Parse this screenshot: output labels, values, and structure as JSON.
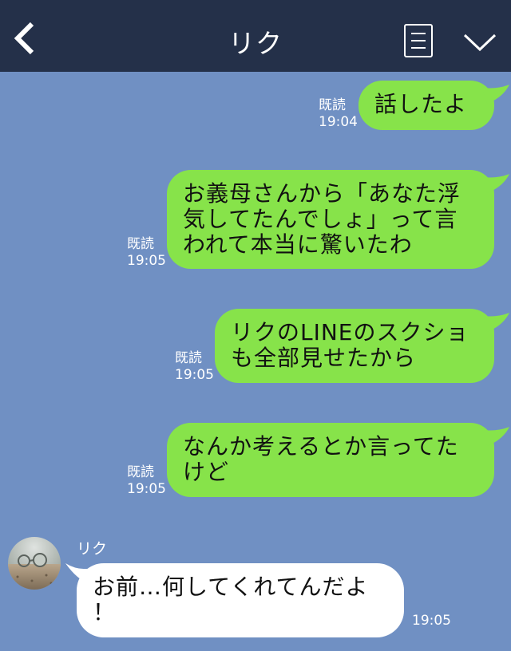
{
  "header": {
    "back_icon": "chevron-left-icon",
    "title": "リク",
    "menu_icon": "notes-icon",
    "collapse_icon": "chevron-down-icon"
  },
  "messages": [
    {
      "from": "me",
      "text": "話したよ",
      "read": "既読",
      "time": "19:04"
    },
    {
      "from": "me",
      "text": "お義母さんから「あなた浮気してたんでしょ」って言われて本当に驚いたわ",
      "lines": [
        "お義母さんから「あなた浮",
        "気してたんでしょ」って言",
        "われて本当に驚いたわ"
      ],
      "read": "既読",
      "time": "19:05"
    },
    {
      "from": "me",
      "text": "リクのLINEのスクショも全部見せたから",
      "lines": [
        "リクのLINEのスクショ",
        "も全部見せたから"
      ],
      "read": "既読",
      "time": "19:05"
    },
    {
      "from": "me",
      "text": "なんか考えるとか言ってたけど",
      "lines": [
        "なんか考えるとか言ってた",
        "けど"
      ],
      "read": "既読",
      "time": "19:05"
    },
    {
      "from": "them",
      "sender": "リク",
      "avatar": "profile-photo",
      "text": "お前…何してくれてんだよ！",
      "lines": [
        "お前…何してくれてんだよ",
        "！"
      ],
      "time": "19:05"
    }
  ],
  "colors": {
    "background": "#7090c3",
    "header": "#243049",
    "my_bubble": "#87e34a",
    "their_bubble": "#ffffff"
  }
}
